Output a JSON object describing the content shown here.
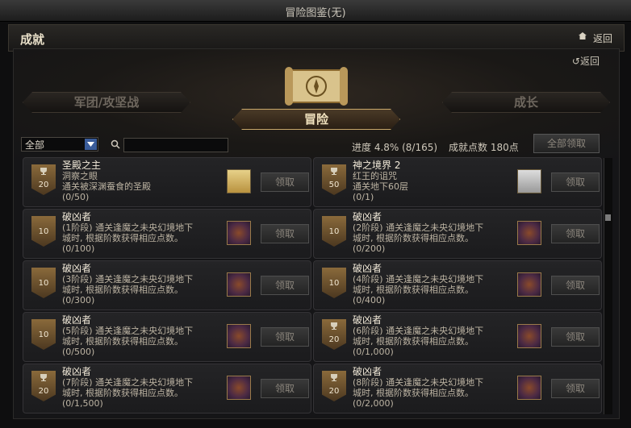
{
  "window": {
    "title": "冒险图鉴(无)"
  },
  "header": {
    "title": "成就",
    "back_label": "返回"
  },
  "main": {
    "back_label": "返回",
    "tabs": [
      {
        "label": "军团/攻坚战",
        "active": false
      },
      {
        "label": "冒险",
        "active": true
      },
      {
        "label": "成长",
        "active": false
      }
    ],
    "filter": {
      "selected": "全部"
    },
    "search": {
      "placeholder": ""
    },
    "progress_text": "进度  4.8% (8/165)",
    "points_text": "成就点数 180点",
    "claim_all_label": "全部领取"
  },
  "cards": [
    {
      "name": "圣殿之主",
      "line1": "洞察之眼",
      "line2": "通关被深渊蚕食的圣殿",
      "count": "(0/50)",
      "badge": "20",
      "cup": true,
      "icon": "map-icon",
      "claim": "领取"
    },
    {
      "name": "神之境界 2",
      "line1": "红王的诅咒",
      "line2": "通关地下60层",
      "count": "(0/1)",
      "badge": "50",
      "cup": true,
      "icon": "scroll-paper-icon",
      "claim": "领取"
    },
    {
      "name": "破凶者",
      "line1": "(1阶段) 通关逢魔之未央幻境地下",
      "line2": "城时, 根据阶数获得相应点数。",
      "count": "(0/100)",
      "badge": "10",
      "cup": false,
      "icon": "emblem-icon",
      "claim": "领取"
    },
    {
      "name": "破凶者",
      "line1": "(2阶段) 通关逢魔之未央幻境地下",
      "line2": "城时, 根据阶数获得相应点数。",
      "count": "(0/200)",
      "badge": "10",
      "cup": false,
      "icon": "emblem-icon",
      "claim": "领取"
    },
    {
      "name": "破凶者",
      "line1": "(3阶段) 通关逢魔之未央幻境地下",
      "line2": "城时, 根据阶数获得相应点数。",
      "count": "(0/300)",
      "badge": "10",
      "cup": false,
      "icon": "emblem-icon",
      "claim": "领取"
    },
    {
      "name": "破凶者",
      "line1": "(4阶段) 通关逢魔之未央幻境地下",
      "line2": "城时, 根据阶数获得相应点数。",
      "count": "(0/400)",
      "badge": "10",
      "cup": false,
      "icon": "emblem-icon",
      "claim": "领取"
    },
    {
      "name": "破凶者",
      "line1": "(5阶段) 通关逢魔之未央幻境地下",
      "line2": "城时, 根据阶数获得相应点数。",
      "count": "(0/500)",
      "badge": "10",
      "cup": false,
      "icon": "emblem-icon",
      "claim": "领取"
    },
    {
      "name": "破凶者",
      "line1": "(6阶段) 通关逢魔之未央幻境地下",
      "line2": "城时, 根据阶数获得相应点数。",
      "count": "(0/1,000)",
      "badge": "20",
      "cup": true,
      "icon": "emblem-icon",
      "claim": "领取"
    },
    {
      "name": "破凶者",
      "line1": "(7阶段) 通关逢魔之未央幻境地下",
      "line2": "城时, 根据阶数获得相应点数。",
      "count": "(0/1,500)",
      "badge": "20",
      "cup": true,
      "icon": "emblem-icon",
      "claim": "领取"
    },
    {
      "name": "破凶者",
      "line1": "(8阶段) 通关逢魔之未央幻境地下",
      "line2": "城时, 根据阶数获得相应点数。",
      "count": "(0/2,000)",
      "badge": "20",
      "cup": true,
      "icon": "emblem-icon",
      "claim": "领取"
    }
  ]
}
